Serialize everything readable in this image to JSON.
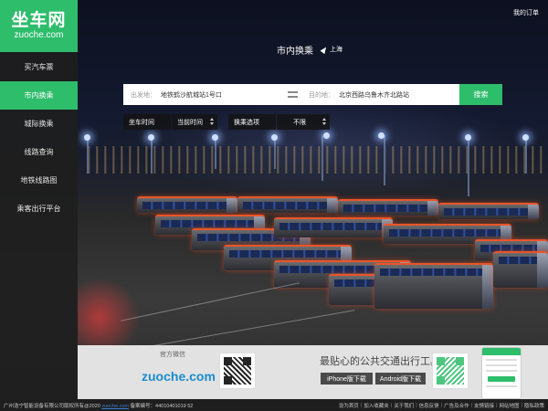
{
  "logo": {
    "title": "坐车网",
    "subtitle": "zuoche.com"
  },
  "nav": {
    "items": [
      {
        "label": "买汽车票"
      },
      {
        "label": "市内换乘"
      },
      {
        "label": "城际换乘"
      },
      {
        "label": "线路查询"
      },
      {
        "label": "地铁线路图"
      },
      {
        "label": "乘客出行平台"
      }
    ],
    "active_index": 1
  },
  "header": {
    "my_orders": "我的订单"
  },
  "transfer": {
    "title": "市内换乘",
    "city": "上海"
  },
  "search": {
    "from_label": "出发地：",
    "from_value": "地铁鹤沙航城站1号口",
    "to_label": "目的地：",
    "to_value": "北京西路乌鲁木齐北路站",
    "button": "搜索"
  },
  "filters": {
    "time_label": "坐车时间",
    "time_value": "当前时间",
    "option_label": "换乘选项",
    "option_value": "不限"
  },
  "banner": {
    "wechat_label": "官方微信",
    "wechat_logo": "zuoche.com",
    "slogan": "最贴心的公共交通出行工具",
    "iphone_btn": "iPhone版下载",
    "android_btn": "Android版下载"
  },
  "footer": {
    "company": "广州浩宁智能设备有限公司版权所有@2020",
    "domain": "zuoche.com",
    "icp": "备案编号：44010401019 52",
    "links": [
      "设为首页",
      "加入收藏夹",
      "关于我们",
      "信息反馈",
      "广告及合作",
      "友情链接",
      "网站地图",
      "隐私政策"
    ]
  },
  "colors": {
    "brand_green": "#2ebd6b"
  }
}
